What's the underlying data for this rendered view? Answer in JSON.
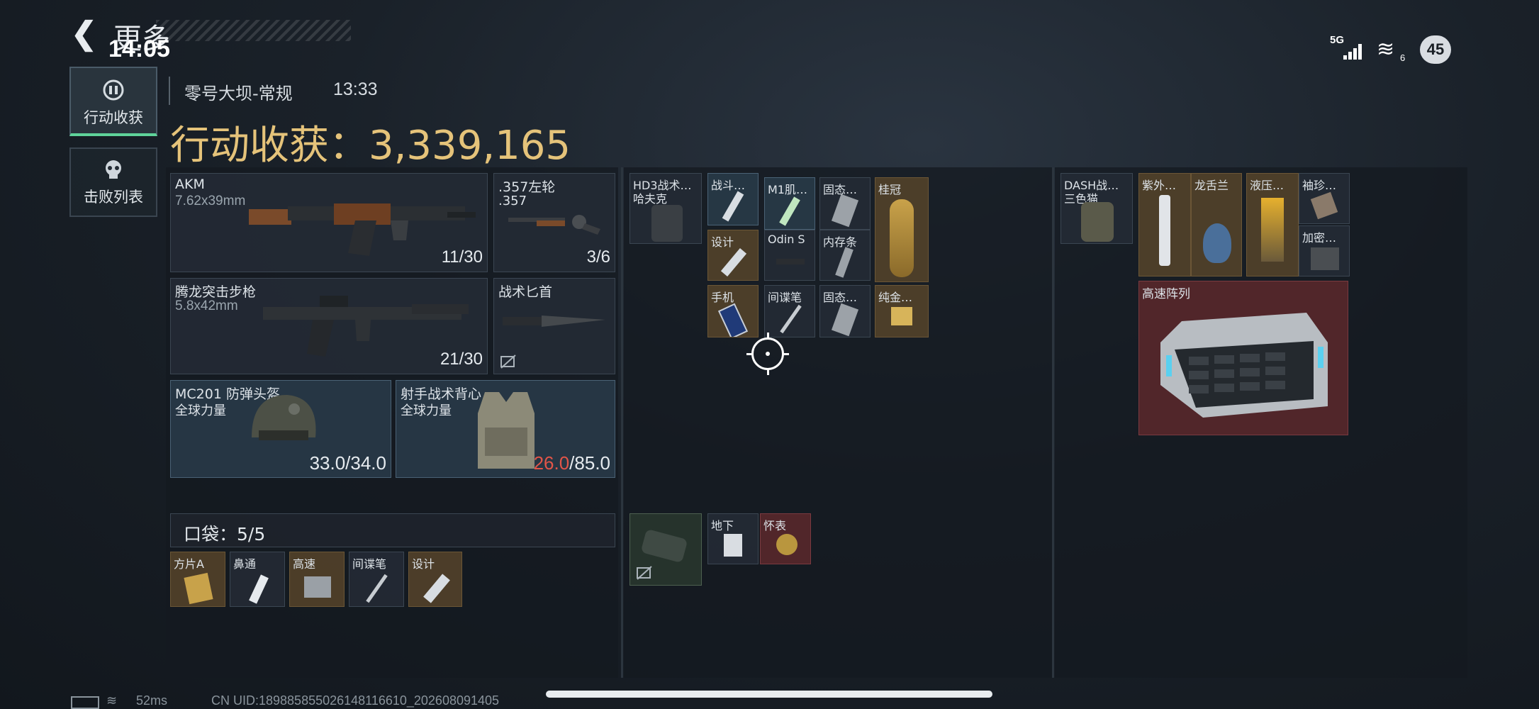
{
  "header": {
    "back_label": "更多",
    "time": "14:05"
  },
  "status": {
    "network": "5G",
    "wifi_num": "6",
    "battery": "45"
  },
  "tabs": [
    {
      "label": "行动收获",
      "icon": "loot-icon",
      "active": true
    },
    {
      "label": "击败列表",
      "icon": "skull-icon",
      "active": false
    }
  ],
  "match": {
    "map": "零号大坝-常规",
    "duration": "13:33",
    "loot_label": "行动收获：3,339,165"
  },
  "loadout": {
    "primary": {
      "name": "AKM",
      "caliber": "7.62x39mm",
      "ammo": "11/30"
    },
    "sidearm": {
      "name": ".357左轮",
      "caliber": ".357",
      "ammo": "3/6"
    },
    "secondary": {
      "name": "腾龙突击步枪",
      "caliber": "5.8x42mm",
      "ammo": "21/30"
    },
    "melee": {
      "name": "战术匕首"
    },
    "helmet": {
      "name": "MC201 防弹头盔",
      "brand": "全球力量",
      "durability": "33.0/34.0"
    },
    "armor": {
      "name": "射手战术背心",
      "brand": "全球力量",
      "durability_current": "26.0",
      "durability_max": "/85.0"
    }
  },
  "pocket": {
    "label": "口袋：5/5",
    "items": [
      "方片A",
      "鼻通",
      "高速",
      "间谍笔",
      "设计"
    ]
  },
  "chest": {
    "rig_name": "HD3战术…",
    "rig_sub": "哈夫克",
    "items": [
      "战斗…",
      "M1肌…",
      "固态…",
      "桂冠",
      "设计",
      "Odin S",
      "内存条",
      "手机",
      "间谍笔",
      "固态…",
      "纯金…"
    ]
  },
  "safebox": {
    "items": [
      "地下",
      "怀表"
    ]
  },
  "backpack": {
    "name": "DASH战…",
    "sub": "三色猫",
    "items": [
      "紫外…",
      "龙舌兰",
      "液压…",
      "袖珍…",
      "加密…",
      "高速阵列"
    ]
  },
  "footer": {
    "ping": "52ms",
    "uid": "CN UID:18988585502614811661​0_202608091405"
  }
}
